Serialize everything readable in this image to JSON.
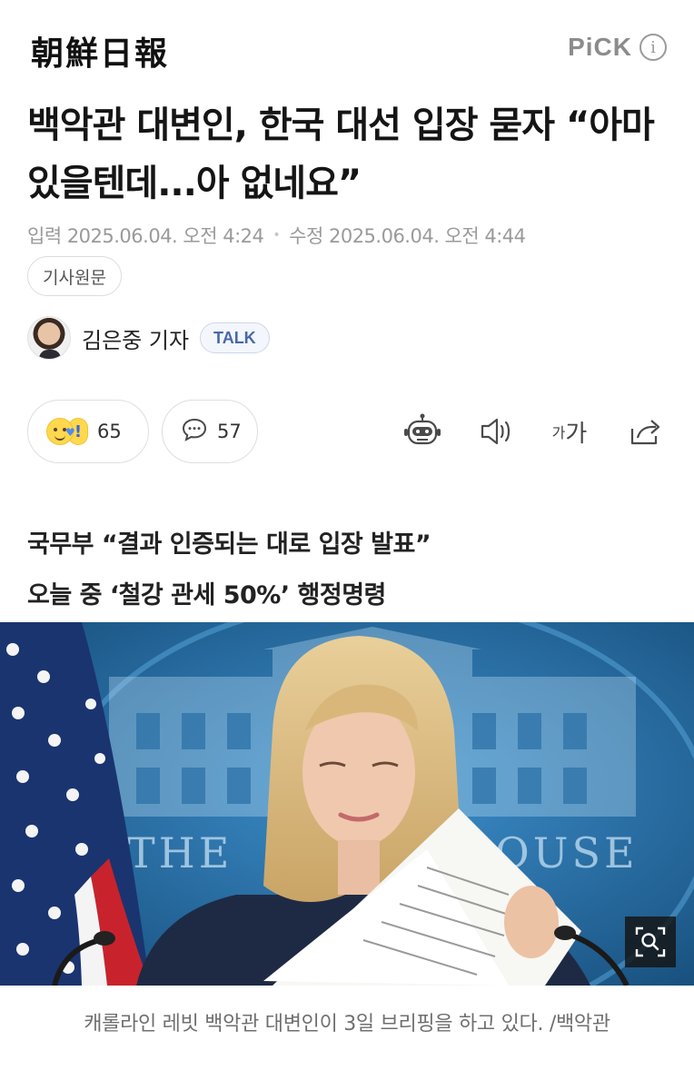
{
  "header": {
    "logo_text": "朝鮮日報",
    "pick_label": "PiCK",
    "info_symbol": "i"
  },
  "article": {
    "headline": "백악관 대변인, 한국 대선 입장 묻자 “아마 있을텐데...아 없네요”",
    "input_date": "입력 2025.06.04. 오전 4:24",
    "modified_date": "수정 2025.06.04. 오전 4:44",
    "original_link_label": "기사원문",
    "reporter_name": "김은중 기자",
    "talk_label": "TALK"
  },
  "actions": {
    "reaction_count": "65",
    "comment_count": "57",
    "font_size_label_small": "가",
    "font_size_label_large": "가",
    "icons": [
      "reaction-emoji-icon",
      "comment-bubble-icon",
      "robot-summary-icon",
      "speaker-icon",
      "font-size-icon",
      "share-icon"
    ]
  },
  "subheadlines": [
    "국무부 “결과 인증되는 대로 입장 발표”",
    "오늘 중 ‘철강 관세 50%’ 행정명령"
  ],
  "photo": {
    "backdrop_text_left": "THE",
    "backdrop_text_right": "OUSE",
    "caption": "캐롤라인 레빗 백악관 대변인이 3일 브리핑을 하고 있다. /백악관"
  },
  "colors": {
    "backdrop_blue": "#1f6fa8",
    "talk_blue": "#4a68a8",
    "meta_gray": "#9a9a9a"
  }
}
